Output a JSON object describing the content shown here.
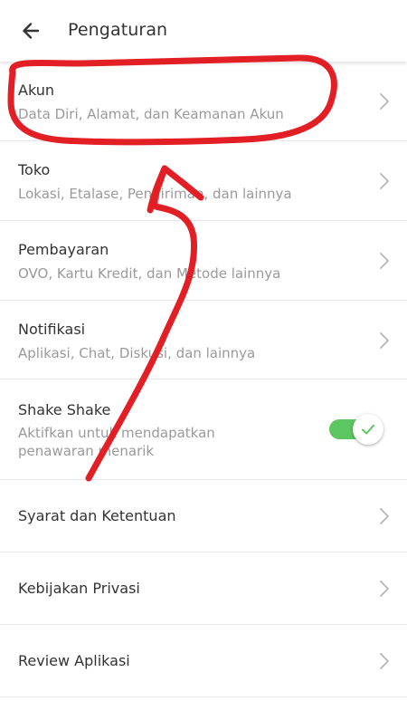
{
  "header": {
    "title": "Pengaturan"
  },
  "menu": [
    {
      "title": "Akun",
      "subtitle": "Data Diri, Alamat, dan Keamanan Akun"
    },
    {
      "title": "Toko",
      "subtitle": "Lokasi, Etalase, Pengiriman, dan lainnya"
    },
    {
      "title": "Pembayaran",
      "subtitle": "OVO, Kartu Kredit, dan Metode lainnya"
    },
    {
      "title": "Notifikasi",
      "subtitle": "Aplikasi, Chat, Diskusi, dan lainnya"
    }
  ],
  "shake": {
    "title": "Shake Shake",
    "subtitle_line1": "Aktifkan untuk mendapatkan",
    "subtitle_line2": "penawaran menarik",
    "enabled": true
  },
  "links": [
    {
      "title": "Syarat dan Ketentuan"
    },
    {
      "title": "Kebijakan Privasi"
    },
    {
      "title": "Review Aplikasi"
    }
  ],
  "colors": {
    "toggle_on": "#5cc760",
    "annotation": "#e31f26",
    "chevron": "#b5b5b5"
  },
  "icons": {
    "back": "arrow-left-icon",
    "chevron": "chevron-right-icon",
    "check": "check-icon"
  }
}
